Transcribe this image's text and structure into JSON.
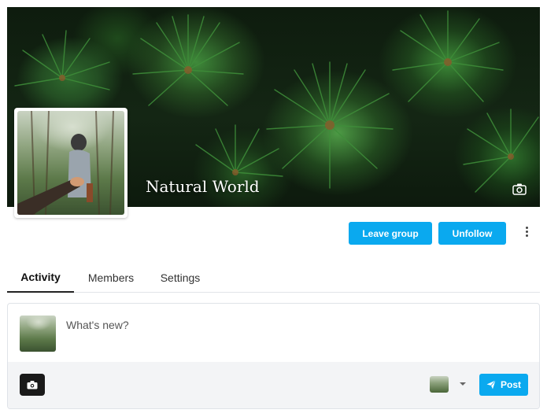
{
  "group": {
    "name": "Natural World"
  },
  "actions": {
    "leave_group_label": "Leave group",
    "unfollow_label": "Unfollow"
  },
  "tabs": [
    {
      "label": "Activity",
      "active": true
    },
    {
      "label": "Members",
      "active": false
    },
    {
      "label": "Settings",
      "active": false
    }
  ],
  "composer": {
    "placeholder": "What's new?",
    "post_label": "Post"
  },
  "colors": {
    "accent": "#0aa9ef",
    "footer_bg": "#f3f4f6"
  },
  "icons": {
    "cover_camera": "camera-icon",
    "photo_upload": "camera-icon",
    "post": "paper-plane-icon",
    "more": "vertical-ellipsis-icon",
    "privacy_dropdown": "chevron-down-icon"
  }
}
